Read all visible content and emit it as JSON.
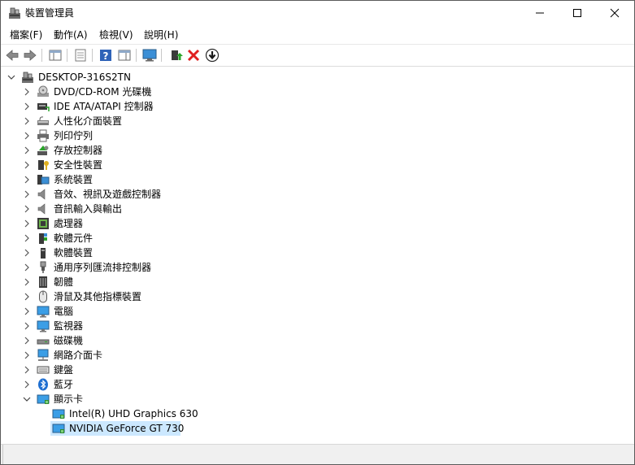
{
  "window": {
    "title": "裝置管理員",
    "minimize_icon": "minimize-icon",
    "maximize_icon": "maximize-icon",
    "close_icon": "close-icon"
  },
  "menu": [
    {
      "label": "檔案(F)"
    },
    {
      "label": "動作(A)"
    },
    {
      "label": "檢視(V)"
    },
    {
      "label": "說明(H)"
    }
  ],
  "toolbar": [
    {
      "name": "back-button",
      "icon": "arrow-left-icon"
    },
    {
      "name": "forward-button",
      "icon": "arrow-right-icon"
    },
    {
      "name": "show-hide-console-tree-button",
      "icon": "console-tree-icon"
    },
    {
      "name": "properties-button",
      "icon": "properties-icon"
    },
    {
      "name": "help-button",
      "icon": "help-icon"
    },
    {
      "name": "action-pane-button",
      "icon": "action-pane-icon"
    },
    {
      "name": "scan-hardware-button",
      "icon": "monitor-scan-icon"
    },
    {
      "name": "update-driver-button",
      "icon": "update-driver-icon"
    },
    {
      "name": "uninstall-device-button",
      "icon": "red-x-icon"
    },
    {
      "name": "disable-device-button",
      "icon": "down-arrow-circle-icon"
    }
  ],
  "tree": {
    "root": {
      "label": "DESKTOP-316S2TN",
      "icon": "computer-icon",
      "expanded": true
    },
    "categories": [
      {
        "label": "DVD/CD-ROM 光碟機",
        "icon": "dvd-drive-icon"
      },
      {
        "label": "IDE ATA/ATAPI 控制器",
        "icon": "ide-controller-icon"
      },
      {
        "label": "人性化介面裝置",
        "icon": "hid-icon"
      },
      {
        "label": "列印佇列",
        "icon": "printer-icon"
      },
      {
        "label": "存放控制器",
        "icon": "storage-controller-icon"
      },
      {
        "label": "安全性裝置",
        "icon": "security-device-icon"
      },
      {
        "label": "系統裝置",
        "icon": "system-device-icon"
      },
      {
        "label": "音效、視訊及遊戲控制器",
        "icon": "speaker-icon"
      },
      {
        "label": "音訊輸入與輸出",
        "icon": "speaker-icon"
      },
      {
        "label": "處理器",
        "icon": "processor-icon"
      },
      {
        "label": "軟體元件",
        "icon": "software-component-icon"
      },
      {
        "label": "軟體裝置",
        "icon": "software-device-icon"
      },
      {
        "label": "通用序列匯流排控制器",
        "icon": "usb-icon"
      },
      {
        "label": "韌體",
        "icon": "firmware-icon"
      },
      {
        "label": "滑鼠及其他指標裝置",
        "icon": "mouse-icon"
      },
      {
        "label": "電腦",
        "icon": "monitor-icon"
      },
      {
        "label": "監視器",
        "icon": "monitor-icon"
      },
      {
        "label": "磁碟機",
        "icon": "disk-drive-icon"
      },
      {
        "label": "網路介面卡",
        "icon": "network-adapter-icon"
      },
      {
        "label": "鍵盤",
        "icon": "keyboard-icon"
      },
      {
        "label": "藍牙",
        "icon": "bluetooth-icon"
      },
      {
        "label": "顯示卡",
        "icon": "display-adapter-icon",
        "expanded": true
      }
    ],
    "display_adapters": [
      {
        "label": "Intel(R) UHD Graphics 630",
        "icon": "display-adapter-icon"
      },
      {
        "label": "NVIDIA GeForce GT 730",
        "icon": "display-adapter-icon",
        "selected": true
      }
    ]
  },
  "colors": {
    "selection": "#cce8ff",
    "uninstall_red": "#e02020",
    "help_blue": "#2f63b8"
  }
}
